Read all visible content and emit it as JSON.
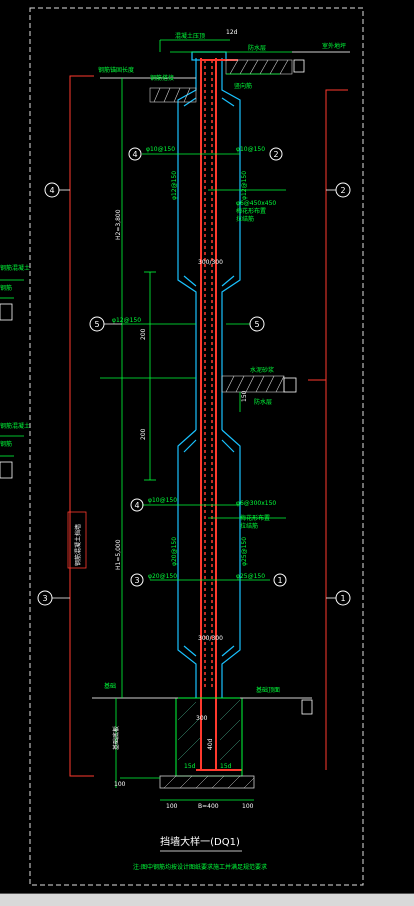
{
  "drawing": {
    "title": "挡墙大样一(DQ1)",
    "note": "注:图中钢筋均按设计图纸要求施工并满足规范要求",
    "colors": {
      "background": "#000000",
      "frame": "#e0e0e0",
      "concrete": "#19c2ff",
      "rebar": "#ff3a2e",
      "annotation": "#00ff3a",
      "dimension": "#ffffff",
      "label": "#ffffff"
    }
  },
  "labels": {
    "top_width": "12d",
    "top_left": "混凝土压顶",
    "top_right_1": "防水层",
    "top_right_2": "竖向筋",
    "top_far_right": "室外地坪",
    "lap_left": "钢筋锚固长度",
    "left_note": "钢筋搭接",
    "bar_1_top": "φ10@150",
    "bar_2_top": "φ10@150",
    "bar_4_vert": "φ12@150",
    "bar_2_vert": "φ12@150",
    "tie_top": "φ6@450x450",
    "tie_top_2": "梅花形布置",
    "tie_top_3": "拉结筋",
    "dim_h_top": "H2=3,800",
    "mid_ratio": "300/300",
    "bar_5": "φ12@150",
    "dim_200_a": "200",
    "dim_200_b": "200",
    "mid_right_1": "水泥砂浆",
    "mid_right_2": "防水层",
    "side_dim_a": "150",
    "bar_4_low": "φ10@150",
    "tie_low": "φ6@300x150",
    "tie_low_2": "梅花形布置",
    "tie_low_3": "拉结筋",
    "bar_3": "φ20@150",
    "bar_1": "φ25@150",
    "bar_3_vert": "φ20@150",
    "bar_1_vert": "φ25@150",
    "dim_h_low": "H1=5,000",
    "left_box": "钢筋混凝土挡墙",
    "ground_left": "基础",
    "ground_right": "基础顶面",
    "found_1": "300",
    "found_2": "15d",
    "found_3": "15d",
    "found_4": "40d",
    "found_side": "100",
    "found_base_l": "100",
    "found_base_r": "100",
    "found_bottom": "B=400",
    "found_left_vert": "基础底板",
    "left_cut_1": "钢筋混凝土",
    "left_cut_2": "钢筋",
    "left_cut_3": "钢筋混凝土",
    "left_cut_4": "钢筋",
    "callout_1": "1",
    "callout_2": "2",
    "callout_3": "3",
    "callout_4": "4",
    "callout_5": "5"
  }
}
